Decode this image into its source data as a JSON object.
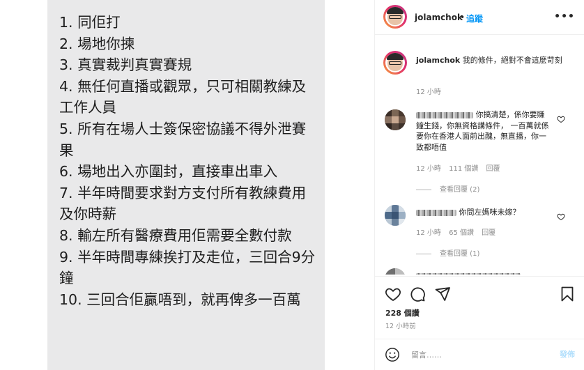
{
  "post_image": {
    "rules": [
      "1. 同佢打",
      "2. 場地你揀",
      "3. 真實裁判真實賽規",
      "4. 無任何直播或觀眾，只可相關教練及工作人員",
      "5. 所有在場人士簽保密協議不得外泄賽果",
      "6. 場地出入亦圍封，直接車出車入",
      "7. 半年時間要求對方支付所有教練費用及你時薪",
      "8. 輸左所有醫療費用佢需要全數付款",
      "9. 半年時間專練挨打及走位，三回合9分鐘",
      "10. 三回合佢贏唔到，就再俾多一百萬"
    ]
  },
  "header": {
    "username": "jolamchok",
    "separator": "•",
    "follow_label": "追蹤",
    "more_icon": "more-horizontal-icon"
  },
  "comments": {
    "caption": {
      "username": "jolamchok",
      "text": "我的條件，絕對不會這麼苛刻",
      "time": "12 小時"
    },
    "items": [
      {
        "text": "你搞清楚，係你要賺鐘生錢，你無資格講條件， 一百萬就係要你在香港人面前出醜，無直播，你一致都唔值",
        "time": "12 小時",
        "likes": "111 個讚",
        "reply": "回覆",
        "view_replies": "查看回覆 (2)"
      },
      {
        "text": "你問左媽咪未嫁？",
        "time": "12 小時",
        "likes": "65 個讚",
        "reply": "回覆",
        "view_replies": "查看回覆 (1)"
      }
    ]
  },
  "actions": {
    "like_icon": "heart-icon",
    "comment_icon": "comment-icon",
    "share_icon": "send-icon",
    "save_icon": "bookmark-icon",
    "likes_count": "228 個讚",
    "posted_time": "12 小時前"
  },
  "add_comment": {
    "emoji_icon": "emoji-icon",
    "placeholder": "留言……",
    "post_label": "發佈"
  },
  "colors": {
    "link_blue": "#0095f6",
    "post_disabled": "#b2dffc",
    "secondary_text": "#8e8e8e",
    "image_bg": "#e9e9ea"
  }
}
